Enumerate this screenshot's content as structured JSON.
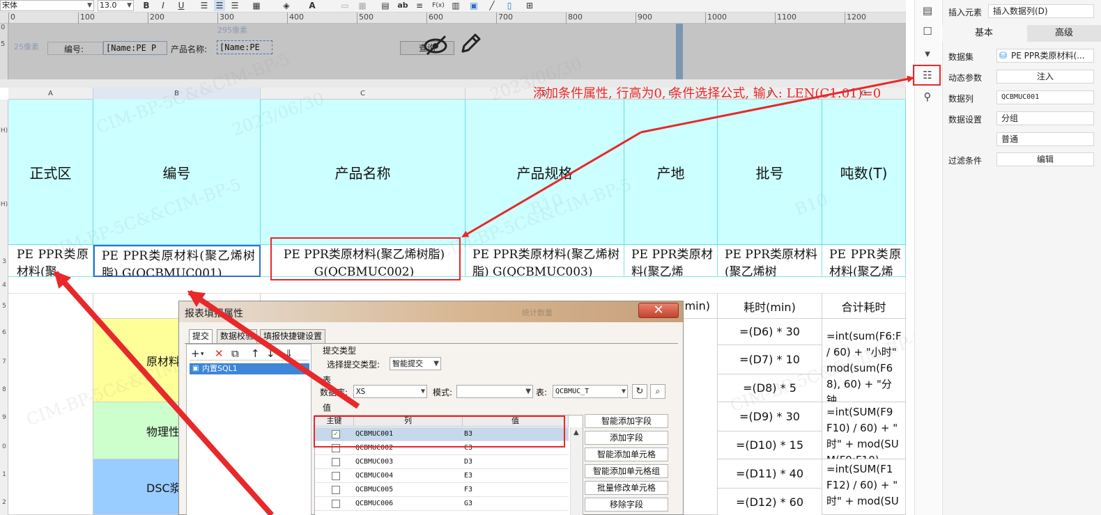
{
  "toolbar": {
    "font_name": "宋体",
    "font_size": "13.0",
    "icons": [
      "bold-icon",
      "italic-icon",
      "underline-icon",
      "align-left-icon",
      "align-center-icon",
      "align-right-icon",
      "border-icon",
      "fill-color-icon",
      "font-color-icon",
      "merge-icon",
      "table-icon",
      "insert-cell-icon",
      "text-icon",
      "wrap-icon",
      "formula-icon",
      "chart-icon",
      "image-icon",
      "slash-icon",
      "attach-icon",
      "more-icon"
    ],
    "bold": "B",
    "italic": "I",
    "underline": "U",
    "text_ab": "ab",
    "formula": "F(x)"
  },
  "ruler": {
    "marks": [
      "0",
      "100",
      "200",
      "300",
      "400",
      "500",
      "600",
      "700",
      "800",
      "900",
      "1000",
      "1100",
      "1200"
    ]
  },
  "param_panel": {
    "vruler_top": "0",
    "vruler_25": "5",
    "height_label": "25像素",
    "width_label": "295像素",
    "label_number": "编号:",
    "field_number": "[Name:PE   P",
    "label_product": "产品名称:",
    "field_product": "[Name:PE",
    "query_button": "查询"
  },
  "sheet": {
    "columns": [
      "A",
      "B",
      "C",
      "D",
      "E",
      "F",
      "G"
    ],
    "row_labels": {
      "r1": "H)",
      "r2": "H)",
      "r3": "3",
      "r4": "4",
      "r5": "5",
      "r6": "6",
      "r7": "7",
      "r8": "8",
      "r9": "9",
      "r10": "0",
      "r11": "1",
      "r12": "2"
    },
    "header_row": [
      "正式区",
      "编号",
      "产品名称",
      "产品规格",
      "产地",
      "批号",
      "吨数(T)"
    ],
    "data_row": [
      "PE  PPR类原材料(聚",
      "PE  PPR类原材料(聚乙烯树脂) G(QCBMUC001)",
      "PE  PPR类原材料(聚乙烯树脂) G(QCBMUC002)",
      "PE  PPR类原材料(聚乙烯树脂) G(QCBMUC003)",
      "PE  PPR类原材料(聚乙烯",
      "PE  PPR类原材料(聚乙烯树",
      "PE  PPR类原材料(聚乙烯"
    ],
    "lower": {
      "e_header": "(min)",
      "f_header": "耗时(min)",
      "g_header": "合计耗时",
      "f_values": [
        "=(D6) * 30",
        "=(D7) * 10",
        "=(D8) * 5",
        "=(D9) * 30",
        "=(D10) * 15",
        "=(D11) * 40",
        "=(D12) * 60"
      ],
      "g_formula1": "=int(sum(F6:F / 60) + \"小时\" mod(sum(F6 8), 60) + \"分钟",
      "g_formula2": "=int(SUM(F9 F10) / 60) + \" 时\" + mod(SU M(F9:F10), 60)",
      "g_formula3": "=int(SUM(F1 F12) / 60) + \" 时\" + mod(SU",
      "b_groups": [
        "原材料",
        "物理性",
        "DSC浆"
      ]
    },
    "watermarks": [
      "CIM-BP-5C&&CIM-BP-5",
      "2023/06/30",
      "B10"
    ]
  },
  "sidebar": {
    "insert_element_label": "插入元素",
    "insert_element_value": "插入数据列(D)",
    "tab_basic": "基本",
    "tab_advanced": "高级",
    "dataset_label": "数据集",
    "dataset_value": "PE  PPR类原材料(...",
    "dynamic_param_label": "动态参数",
    "dynamic_param_value": "注入",
    "datacol_label": "数据列",
    "datacol_value": "QCBMUC001",
    "data_settings_label": "数据设置",
    "data_settings_value1": "分组",
    "data_settings_value2": "普通",
    "filter_label": "过滤条件",
    "filter_value": "编辑"
  },
  "dialog": {
    "title": "报表填报属性",
    "close": "✕",
    "faded_title": "统计数量",
    "tabs": [
      "提交",
      "数据校验",
      "填报快捷键设置"
    ],
    "sql_item": "内置SQL1",
    "submit_type_title": "提交类型",
    "submit_type_label": "选择提交类型:",
    "submit_type_value": "智能提交",
    "table_title": "表",
    "db_label": "数据库:",
    "db_value": "XS",
    "mode_label": "模式:",
    "mode_value": "",
    "table_label": "表:",
    "table_value": "QCBMUC_T",
    "value_title": "值",
    "grid_headers": [
      "主键",
      "列",
      "值"
    ],
    "rows": [
      {
        "col": "QCBMUC001",
        "val": "B3",
        "checked": "✓"
      },
      {
        "col": "QCBMUC002",
        "val": "C3",
        "checked": ""
      },
      {
        "col": "QCBMUC003",
        "val": "D3",
        "checked": ""
      },
      {
        "col": "QCBMUC004",
        "val": "E3",
        "checked": ""
      },
      {
        "col": "QCBMUC005",
        "val": "F3",
        "checked": ""
      },
      {
        "col": "QCBMUC006",
        "val": "G3",
        "checked": ""
      }
    ],
    "buttons": [
      "智能添加字段",
      "添加字段",
      "智能添加单元格",
      "智能添加单元格组",
      "批量修改单元格",
      "移除字段"
    ]
  },
  "annotation": {
    "text": "添加条件属性, 行高为0, 条件选择公式, 输入: LEN(C1:01)=0"
  },
  "colors": {
    "accent_red": "#e8282a",
    "header_cyan": "#ccffff",
    "yellow": "#ffff99",
    "green": "#ccffcc",
    "blue": "#99ccff"
  }
}
